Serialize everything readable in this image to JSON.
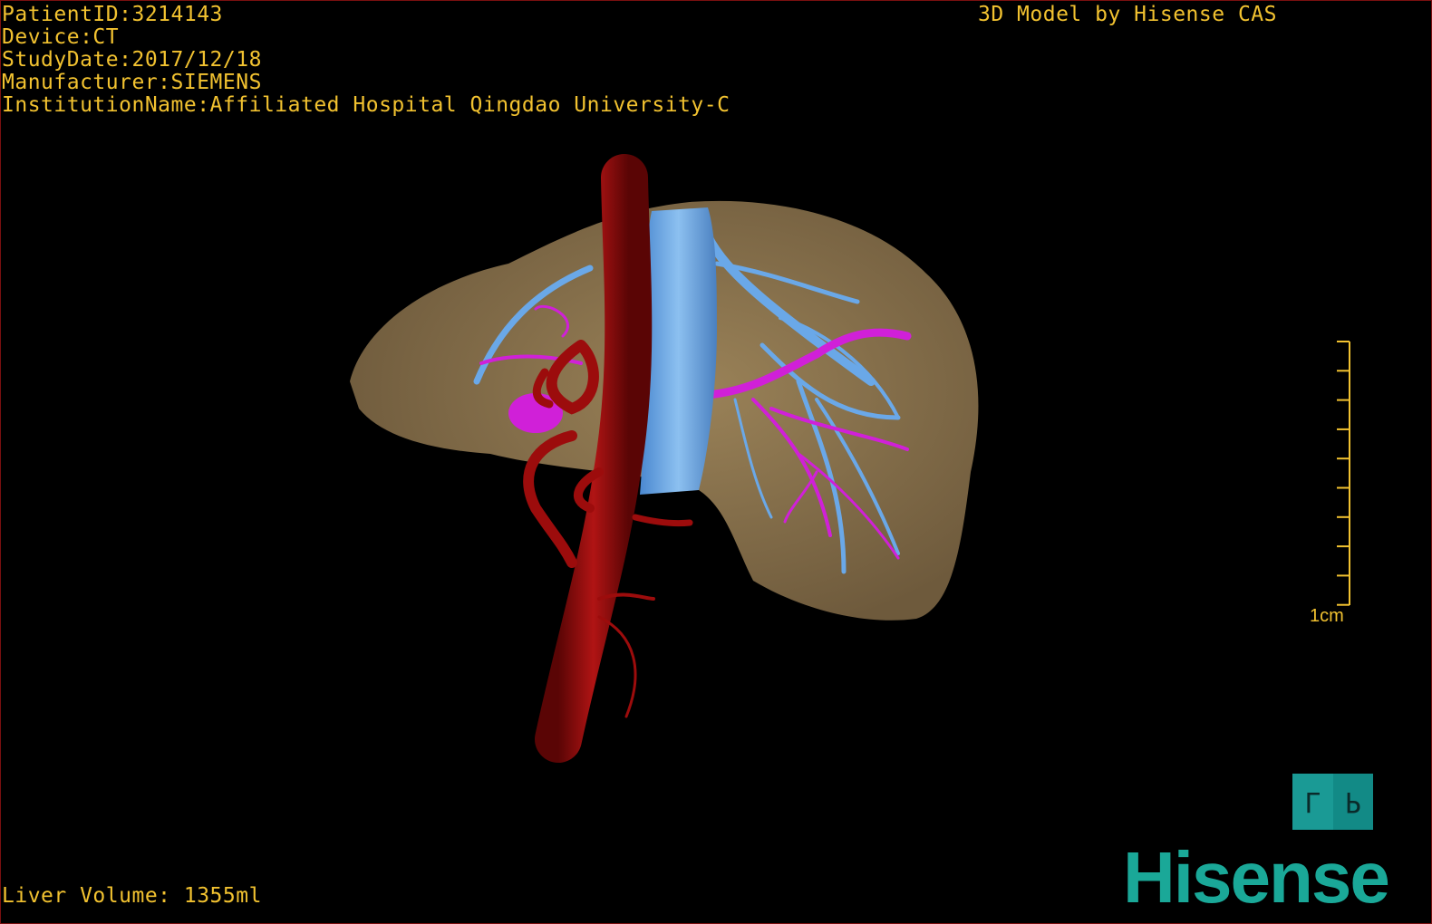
{
  "header": {
    "patient_id": "PatientID:3214143",
    "device": "Device:CT",
    "study_date": "StudyDate:2017/12/18",
    "manufacturer": "Manufacturer:SIEMENS",
    "institution": "InstitutionName:Affiliated Hospital Qingdao University-C",
    "brand_caption": "3D Model by Hisense CAS"
  },
  "footer": {
    "liver_volume": "Liver Volume: 1355ml"
  },
  "scale_bar": {
    "label": "1cm"
  },
  "orientation": {
    "left": "L",
    "right": "P"
  },
  "logo": {
    "text": "Hisense"
  },
  "colors": {
    "text": "#f2c230",
    "liver": "#8a7350",
    "artery": "#9c0c0c",
    "vein": "#6aa8e8",
    "portal": "#d020d8",
    "brand": "#1aa898"
  }
}
